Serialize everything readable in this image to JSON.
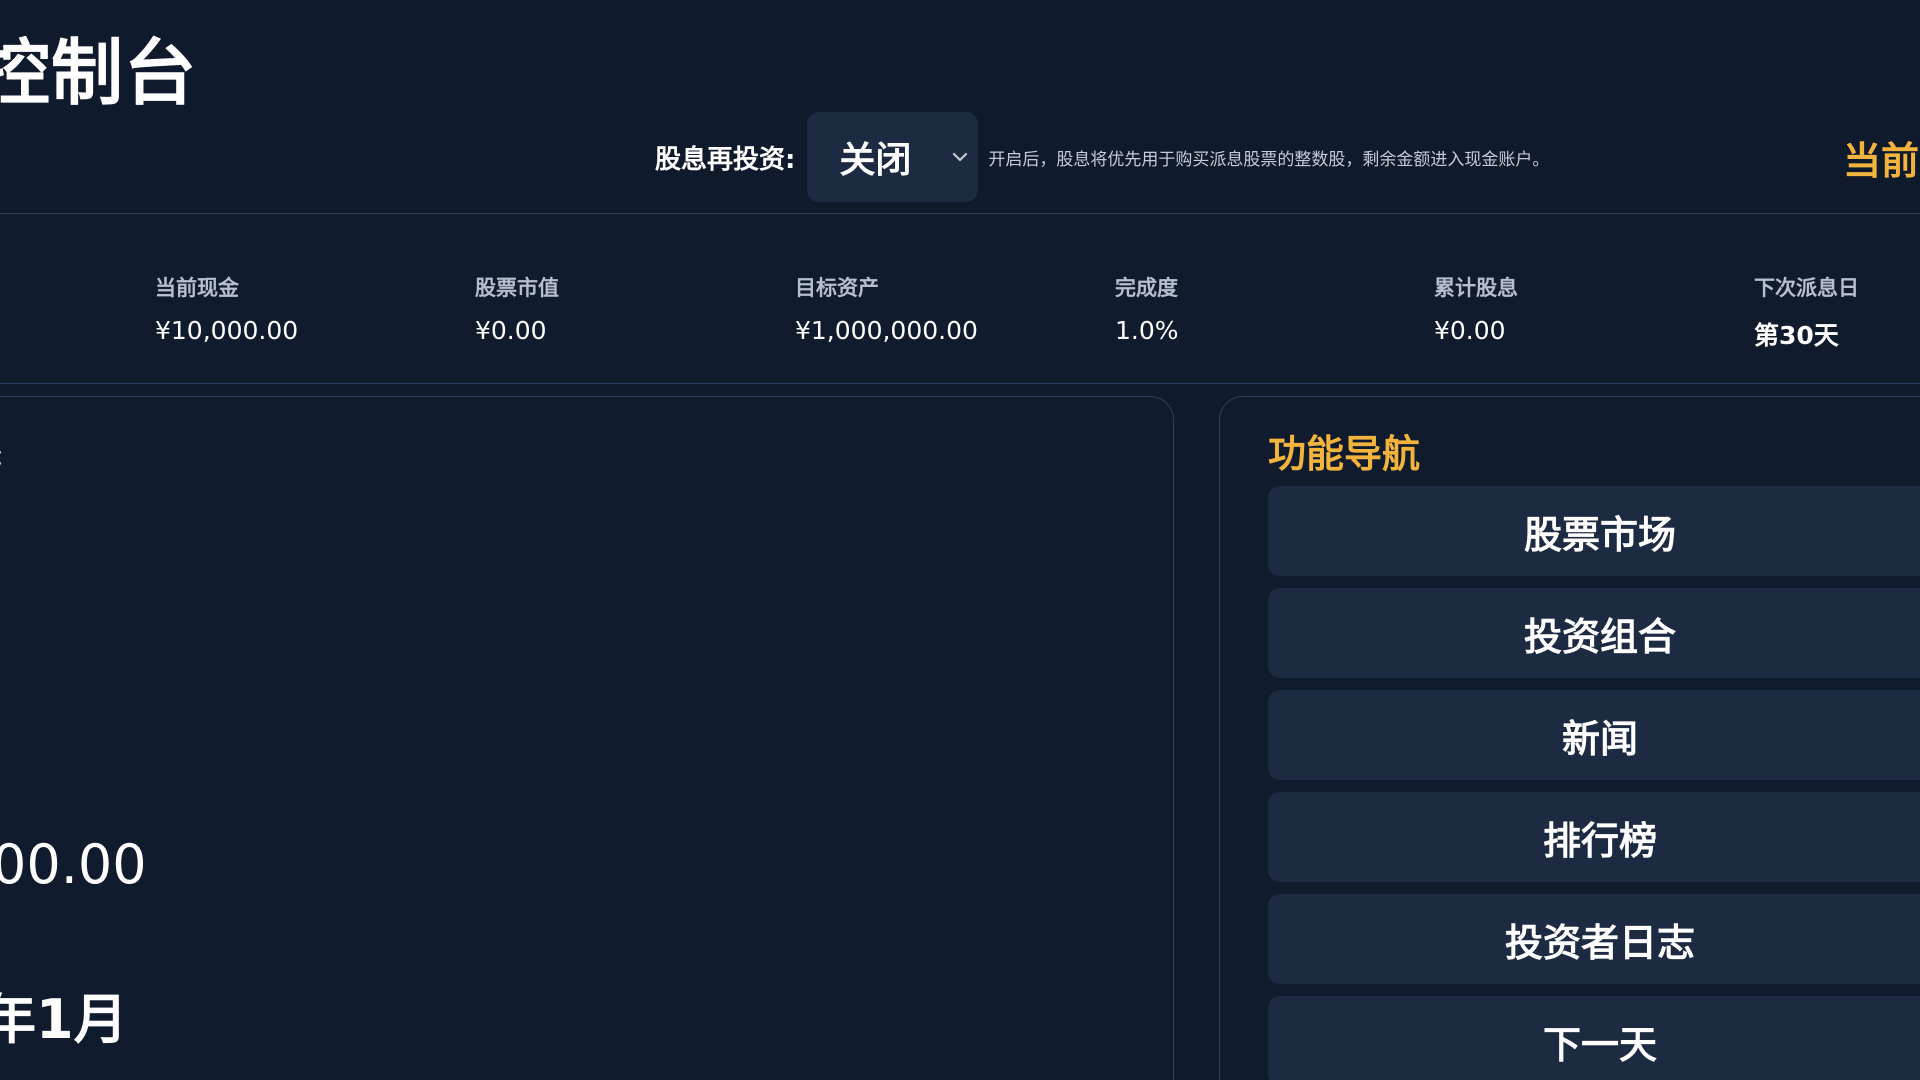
{
  "header": {
    "title": "控制台",
    "accent_fragment": "当前"
  },
  "dividend_reinvest": {
    "label": "股息再投资:",
    "selected": "关闭",
    "hint": "开启后，股息将优先用于购买派息股票的整数股，剩余金额进入现金账户。"
  },
  "stats": [
    {
      "label": "当前现金",
      "value": "¥10,000.00"
    },
    {
      "label": "股票市值",
      "value": "¥0.00"
    },
    {
      "label": "目标资产",
      "value": "¥1,000,000.00"
    },
    {
      "label": "完成度",
      "value": "1.0%"
    },
    {
      "label": "累计股息",
      "value": "¥0.00"
    },
    {
      "label": "下次派息日",
      "value": "第30天"
    }
  ],
  "left_panel": {
    "small_fragment": "：",
    "amount_fragment": "00.00",
    "date_fragment": "年1月"
  },
  "nav": {
    "title": "功能导航",
    "items": [
      {
        "label": "股票市场"
      },
      {
        "label": "投资组合"
      },
      {
        "label": "新闻"
      },
      {
        "label": "排行榜"
      },
      {
        "label": "投资者日志"
      },
      {
        "label": "下一天"
      }
    ]
  },
  "colors": {
    "background": "#0f1a2c",
    "accent": "#f2b43c",
    "button": "#1c2a42",
    "border": "#2b3f5e"
  }
}
